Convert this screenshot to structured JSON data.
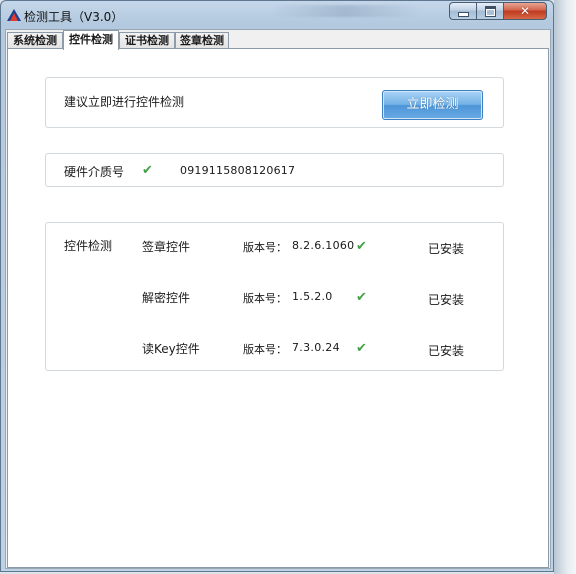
{
  "window": {
    "title": "检测工具（V3.0）",
    "caption_close_glyph": "✕"
  },
  "tabs": [
    {
      "label": "系统检测",
      "active": false
    },
    {
      "label": "控件检测",
      "active": true
    },
    {
      "label": "证书检测",
      "active": false
    },
    {
      "label": "签章检测",
      "active": false
    }
  ],
  "suggestion": {
    "text": "建议立即进行控件检测",
    "button_label": "立即检测"
  },
  "hardware": {
    "label": "硬件介质号",
    "check_icon": "check-icon",
    "value": "0919115808120617"
  },
  "controls": {
    "heading": "控件检测",
    "version_label": "版本号：",
    "check_glyph": "✔",
    "rows": [
      {
        "name": "签章控件",
        "version": "8.2.6.1060",
        "status": "已安装"
      },
      {
        "name": "解密控件",
        "version": "1.5.2.0",
        "status": "已安装"
      },
      {
        "name": "读Key控件",
        "version": "7.3.0.24",
        "status": "已安装"
      }
    ]
  },
  "colors": {
    "accent_button": "#4d95d8",
    "check_green": "#43a047",
    "close_red": "#c0391f"
  }
}
